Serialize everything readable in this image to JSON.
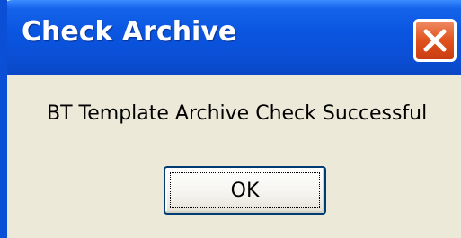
{
  "window": {
    "title": "Check Archive",
    "close_icon": "close-icon",
    "colors": {
      "titlebar": "#0a55e0",
      "body": "#ece9d8",
      "close": "#e0521d"
    }
  },
  "dialog": {
    "message": "BT Template Archive Check Successful",
    "ok_label": "OK"
  }
}
